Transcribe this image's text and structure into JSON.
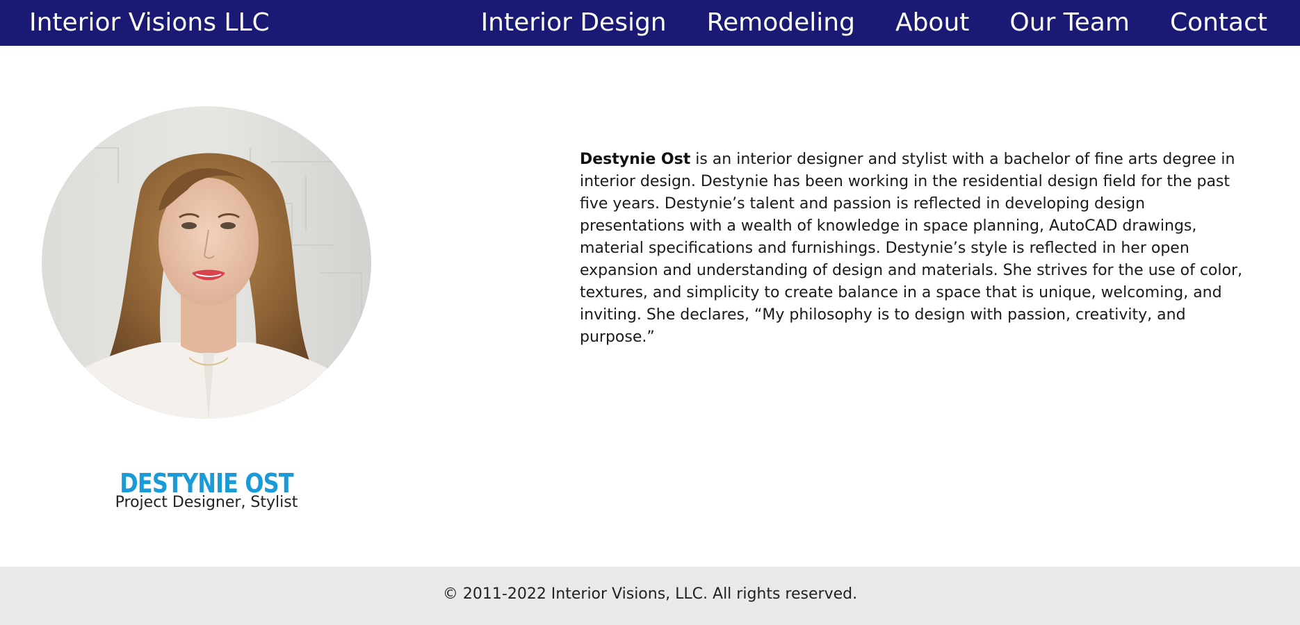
{
  "nav": {
    "brand": "Interior Visions LLC",
    "links": [
      "Interior Design",
      "Remodeling",
      "About",
      "Our Team",
      "Contact"
    ],
    "background": "#1a1a75"
  },
  "member": {
    "name": "DESTYNIE OST",
    "role": "Project Designer, Stylist",
    "name_color": "#1a9ad6",
    "bio_name": "Destynie Ost",
    "bio_text": " is an interior designer and stylist with a bachelor of fine arts degree in interior design. Destynie has been working in the residential design field for the past five years. Destynie’s talent and passion is reflected in developing design presentations with a wealth of knowledge in space planning, AutoCAD drawings, material specifications and furnishings. Destynie’s style is reflected in her open expansion and understanding of design and materials. She strives for the use of color, textures, and simplicity to create balance in a space that is unique, welcoming, and inviting. She declares, “My philosophy is to design with passion, creativity, and purpose.”"
  },
  "footer": {
    "text": "© 2011-2022 Interior Visions, LLC. All rights reserved.",
    "background": "#e9e9e9"
  }
}
